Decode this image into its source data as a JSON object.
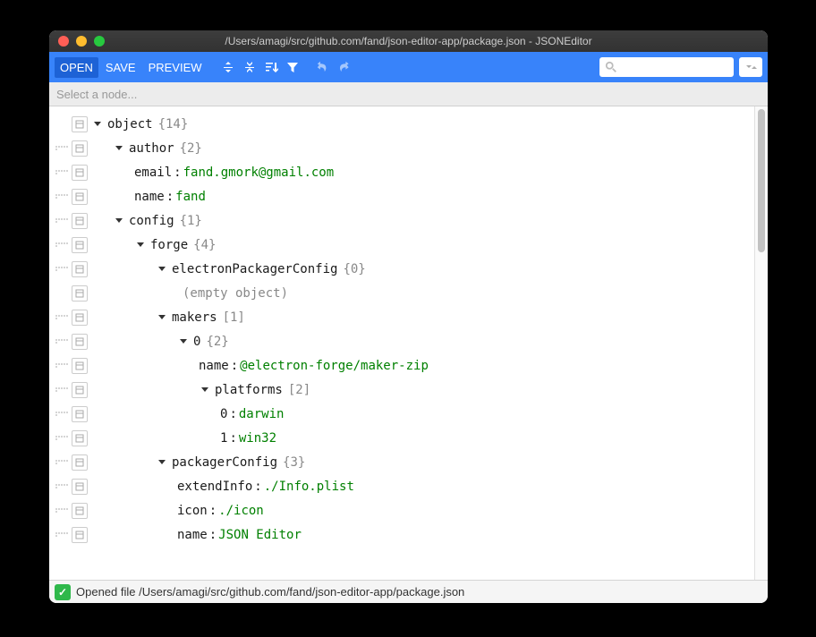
{
  "window": {
    "title": "/Users/amagi/src/github.com/fand/json-editor-app/package.json - JSONEditor"
  },
  "toolbar": {
    "open": "OPEN",
    "save": "SAVE",
    "preview": "PREVIEW"
  },
  "pathbar": {
    "placeholder": "Select a node..."
  },
  "tree": {
    "rows": [
      {
        "indent": 0,
        "drag": false,
        "expand": true,
        "key": "object",
        "info": "{14}"
      },
      {
        "indent": 1,
        "drag": true,
        "expand": true,
        "key": "author",
        "info": "{2}"
      },
      {
        "indent": 2,
        "drag": true,
        "expand": false,
        "key": "email",
        "sep": ":",
        "val": "fand.gmork@gmail.com"
      },
      {
        "indent": 2,
        "drag": true,
        "expand": false,
        "key": "name",
        "sep": ":",
        "val": "fand"
      },
      {
        "indent": 1,
        "drag": true,
        "expand": true,
        "key": "config",
        "info": "{1}"
      },
      {
        "indent": 2,
        "drag": true,
        "expand": true,
        "key": "forge",
        "info": "{4}"
      },
      {
        "indent": 3,
        "drag": true,
        "expand": true,
        "key": "electronPackagerConfig",
        "info": "{0}"
      },
      {
        "indent": 4,
        "drag": false,
        "expand": false,
        "empty": "(empty object)"
      },
      {
        "indent": 3,
        "drag": true,
        "expand": true,
        "key": "makers",
        "info": "[1]"
      },
      {
        "indent": 4,
        "drag": true,
        "expand": true,
        "key": "0",
        "info": "{2}"
      },
      {
        "indent": 5,
        "drag": true,
        "expand": false,
        "key": "name",
        "sep": ":",
        "val": "@electron-forge/maker-zip"
      },
      {
        "indent": 5,
        "drag": true,
        "expand": true,
        "key": "platforms",
        "info": "[2]"
      },
      {
        "indent": 6,
        "drag": true,
        "expand": false,
        "key": "0",
        "sep": ":",
        "val": "darwin"
      },
      {
        "indent": 6,
        "drag": true,
        "expand": false,
        "key": "1",
        "sep": ":",
        "val": "win32"
      },
      {
        "indent": 3,
        "drag": true,
        "expand": true,
        "key": "packagerConfig",
        "info": "{3}"
      },
      {
        "indent": 4,
        "drag": true,
        "expand": false,
        "key": "extendInfo",
        "sep": ":",
        "val": "./Info.plist"
      },
      {
        "indent": 4,
        "drag": true,
        "expand": false,
        "key": "icon",
        "sep": ":",
        "val": "./icon"
      },
      {
        "indent": 4,
        "drag": true,
        "expand": false,
        "key": "name",
        "sep": ":",
        "val": "JSON Editor"
      }
    ]
  },
  "status": {
    "message": "Opened file /Users/amagi/src/github.com/fand/json-editor-app/package.json"
  }
}
